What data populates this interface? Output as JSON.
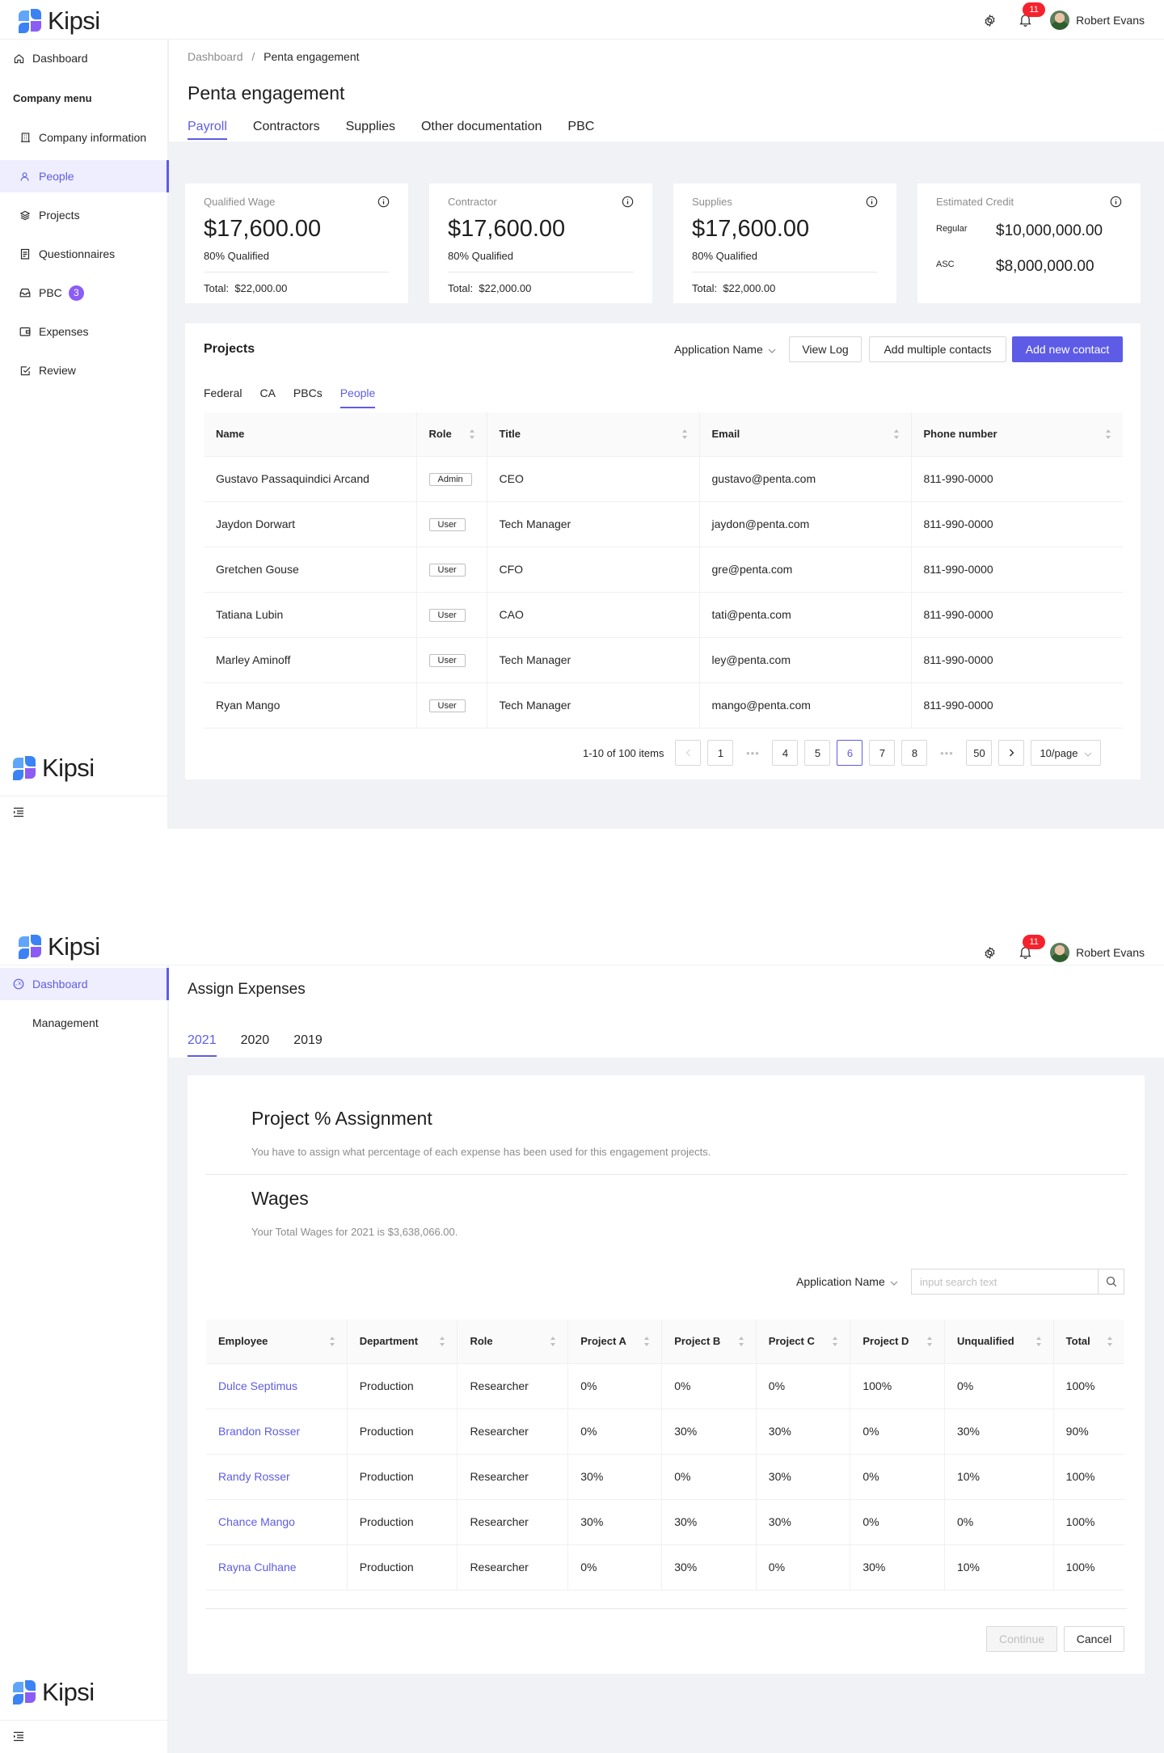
{
  "brand": {
    "name": "Kipsi",
    "colors": {
      "blue": "#3b82f6",
      "cyan": "#60a5fa",
      "purple": "#8b5cf6",
      "accent": "#5e5ce6"
    }
  },
  "user": {
    "name": "Robert Evans",
    "notifications": "11"
  },
  "screen1": {
    "sidebar": {
      "dashboard": "Dashboard",
      "company_menu": "Company menu",
      "items": [
        {
          "label": "Company information",
          "icon": "building-icon"
        },
        {
          "label": "People",
          "icon": "user-icon"
        },
        {
          "label": "Projects",
          "icon": "layers-icon"
        },
        {
          "label": "Questionnaires",
          "icon": "clipboard-icon"
        },
        {
          "label": "PBC",
          "icon": "inbox-icon",
          "badge": "3"
        },
        {
          "label": "Expenses",
          "icon": "wallet-icon"
        },
        {
          "label": "Review",
          "icon": "check-square-icon"
        }
      ]
    },
    "breadcrumb": {
      "root": "Dashboard",
      "sep": "/",
      "current": "Penta engagement"
    },
    "title": "Penta engagement",
    "tabs": [
      "Payroll",
      "Contractors",
      "Supplies",
      "Other documentation",
      "PBC"
    ],
    "stats": [
      {
        "label": "Qualified Wage",
        "value": "$17,600.00",
        "sub": "80% Qualified",
        "total_label": "Total:",
        "total": "$22,000.00"
      },
      {
        "label": "Contractor",
        "value": "$17,600.00",
        "sub": "80% Qualified",
        "total_label": "Total:",
        "total": "$22,000.00"
      },
      {
        "label": "Supplies",
        "value": "$17,600.00",
        "sub": "80% Qualified",
        "total_label": "Total:",
        "total": "$22,000.00"
      }
    ],
    "credit": {
      "label": "Estimated Credit",
      "regular_label": "Regular",
      "regular": "$10,000,000.00",
      "asc_label": "ASC",
      "asc": "$8,000,000.00"
    },
    "projects": {
      "title": "Projects",
      "app_name": "Application Name",
      "buttons": {
        "view_log": "View Log",
        "add_multiple": "Add multiple contacts",
        "add_new": "Add new contact"
      },
      "subtabs": [
        "Federal",
        "CA",
        "PBCs",
        "People"
      ],
      "columns": [
        "Name",
        "Role",
        "Title",
        "Email",
        "Phone number"
      ],
      "rows": [
        [
          "Gustavo Passaquindici Arcand",
          "Admin",
          "CEO",
          "gustavo@penta.com",
          "811-990-0000"
        ],
        [
          "Jaydon Dorwart",
          "User",
          "Tech Manager",
          "jaydon@penta.com",
          "811-990-0000"
        ],
        [
          "Gretchen Gouse",
          "User",
          "CFO",
          "gre@penta.com",
          "811-990-0000"
        ],
        [
          "Tatiana Lubin",
          "User",
          "CAO",
          "tati@penta.com",
          "811-990-0000"
        ],
        [
          "Marley Aminoff",
          "User",
          "Tech Manager",
          "ley@penta.com",
          "811-990-0000"
        ],
        [
          "Ryan Mango",
          "User",
          "Tech Manager",
          "mango@penta.com",
          "811-990-0000"
        ]
      ],
      "pagination": {
        "summary": "1-10 of 100 items",
        "pages": [
          "1",
          "•••",
          "4",
          "5",
          "6",
          "7",
          "8",
          "•••",
          "50"
        ],
        "current": "6",
        "page_size": "10/page"
      }
    }
  },
  "screen2": {
    "sidebar": {
      "dashboard": "Dashboard",
      "management": "Management"
    },
    "title": "Assign Expenses",
    "year_tabs": [
      "2021",
      "2020",
      "2019"
    ],
    "assign_title": "Project % Assignment",
    "assign_desc": "You have to assign what percentage of each expense has been used for this engagement projects.",
    "wages_title": "Wages",
    "wages_desc": "Your Total Wages for 2021 is $3,638,066.00.",
    "app_name": "Application Name",
    "search_placeholder": "input search text",
    "columns": [
      "Employee",
      "Department",
      "Role",
      "Project A",
      "Project B",
      "Project C",
      "Project D",
      "Unqualified",
      "Total"
    ],
    "rows": [
      [
        "Dulce Septimus",
        "Production",
        "Researcher",
        "0%",
        "0%",
        "0%",
        "100%",
        "0%",
        "100%"
      ],
      [
        "Brandon Rosser",
        "Production",
        "Researcher",
        "0%",
        "30%",
        "30%",
        "0%",
        "30%",
        "90%"
      ],
      [
        "Randy Rosser",
        "Production",
        "Researcher",
        "30%",
        "0%",
        "30%",
        "0%",
        "10%",
        "100%"
      ],
      [
        "Chance Mango",
        "Production",
        "Researcher",
        "30%",
        "30%",
        "30%",
        "0%",
        "0%",
        "100%"
      ],
      [
        "Rayna Culhane",
        "Production",
        "Researcher",
        "0%",
        "30%",
        "0%",
        "30%",
        "10%",
        "100%"
      ]
    ],
    "buttons": {
      "continue": "Continue",
      "cancel": "Cancel"
    }
  }
}
